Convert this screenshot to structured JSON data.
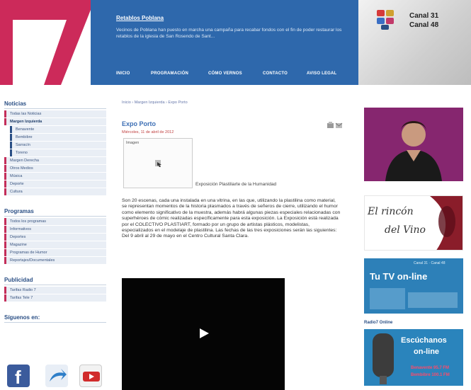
{
  "header": {
    "logo_text": "7",
    "banner_title": "Retablos Poblana",
    "banner_text": "Vecinos de Poblana han puesto en marcha una campaña para recabar fondos con el fin de poder restaurar los retablos de la iglesia de San Rosendo de Sant...",
    "nav": [
      "INICIO",
      "PROGRAMACIÓN",
      "CÓMO VERNOS",
      "CONTACTO",
      "AVISO LEGAL"
    ],
    "channel_lines": [
      "Canal 31",
      "Canal 48"
    ]
  },
  "sidebar": {
    "sections": [
      {
        "title": "Noticias",
        "items": [
          {
            "label": "Todas las Noticias",
            "level": 0
          },
          {
            "label": "Margen Izquierda",
            "level": 0,
            "bold": true
          },
          {
            "label": "Benavente",
            "level": 1
          },
          {
            "label": "Bembibre",
            "level": 1
          },
          {
            "label": "Sarracín",
            "level": 1
          },
          {
            "label": "Toreno",
            "level": 1
          },
          {
            "label": "Margen Derecha",
            "level": 0
          },
          {
            "label": "Otros Medios",
            "level": 0
          },
          {
            "label": "Música",
            "level": 0
          },
          {
            "label": "Deporte",
            "level": 0
          },
          {
            "label": "Cultura",
            "level": 0
          }
        ]
      },
      {
        "title": "Programas",
        "items": [
          {
            "label": "Todos los programas",
            "level": 0
          },
          {
            "label": "Informativos",
            "level": 0
          },
          {
            "label": "Deportes",
            "level": 0
          },
          {
            "label": "Magazine",
            "level": 0
          },
          {
            "label": "Programas de Humor",
            "level": 0
          },
          {
            "label": "Reportajes/Documentales",
            "level": 0
          }
        ]
      },
      {
        "title": "Publicidad",
        "items": [
          {
            "label": "Tarifas Radio 7",
            "level": 0
          },
          {
            "label": "Tarifas Tele 7",
            "level": 0
          }
        ]
      }
    ],
    "social_title": "Síguenos en:",
    "social_icons": [
      "facebook-icon",
      "share-icon",
      "youtube-icon"
    ]
  },
  "article": {
    "breadcrumb": "Inicio › Margen Izquierda › Expo Porto",
    "title": "Expo Porto",
    "date": "Miércoles, 11 de abril de 2012",
    "image_label": "Imagen",
    "caption": "Exposición Plastiliarte de la Humanidad",
    "body": "Son 20 escenas, cada una instalada en una vitrina, en las que, utilizando la plastilina como material, se representan momentos de la historia plasmados a través de señeros de cierre, utilizando el humor como elemento significativo de la muestra, además habrá algunas piezas especiales relacionadas con superhéroes de cómic realizadas específicamente para esta exposición. La Exposición está realizada por el COLECTIVO PLASTIART, formado por un grupo de artistas plásticos, modelistas, especializados en el modelaje de plastilina. Las fechas de las tres exposiciones serán las siguientes: Del 9 abril al 29 de mayo en el Centro Cultural Santa Clara."
  },
  "rightcol": {
    "vino_line1": "El rincón",
    "vino_line2": "del Vino",
    "tv_title": "Tu TV on-line",
    "tv_small": "Canal 31 · Canal 48",
    "radio_label": "Radio7 Online",
    "radio_title1": "Escúchanos",
    "radio_title2": "on-line",
    "radio_freq1": "Benavente 95.7 FM",
    "radio_freq2": "Bembibre 100.1 FM"
  },
  "colors": {
    "brand_blue": "#2e68ac",
    "brand_pink": "#cc2a5a"
  }
}
